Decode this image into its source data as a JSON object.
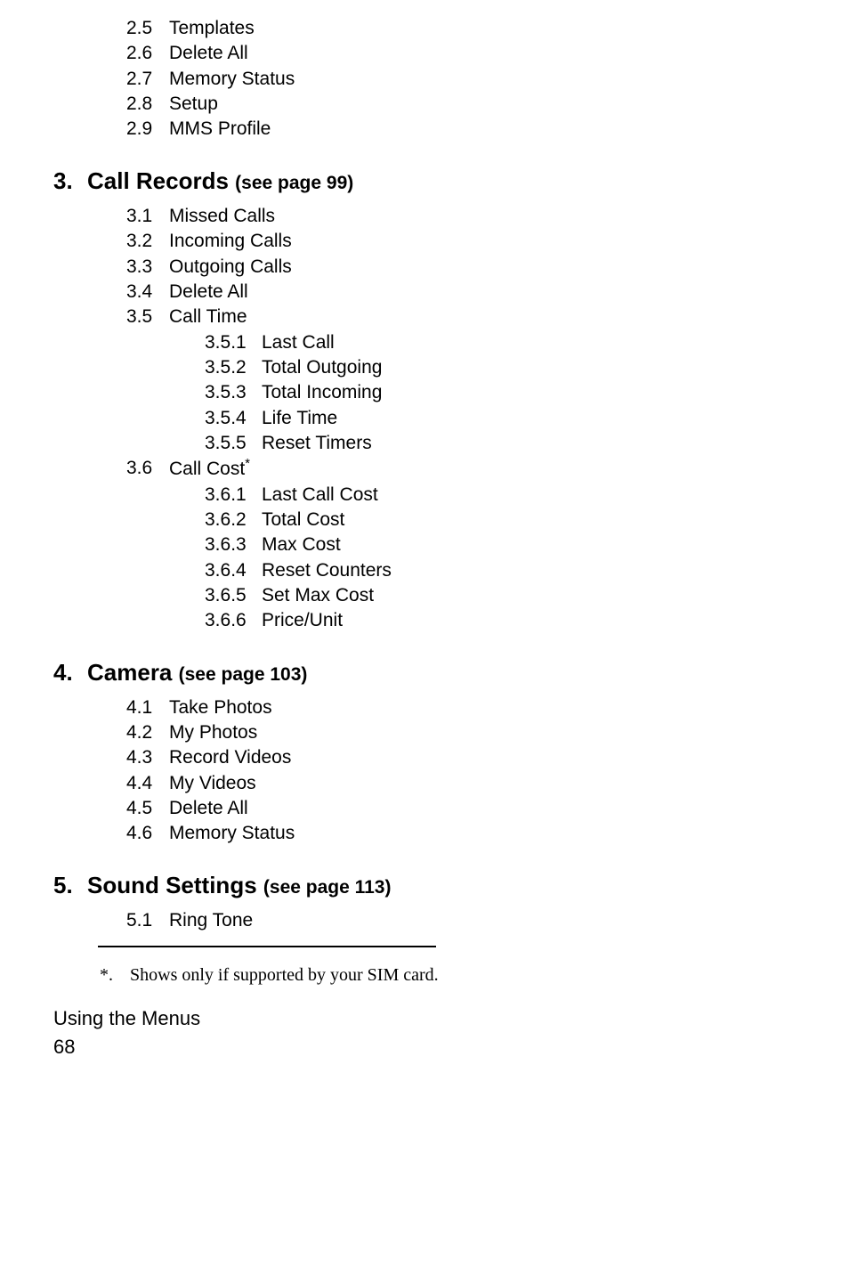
{
  "section2_tail": [
    {
      "n": "2.5",
      "t": "Templates"
    },
    {
      "n": "2.6",
      "t": "Delete All"
    },
    {
      "n": "2.7",
      "t": "Memory Status"
    },
    {
      "n": "2.8",
      "t": "Setup"
    },
    {
      "n": "2.9",
      "t": "MMS Profile"
    }
  ],
  "s3": {
    "num": "3.",
    "title": "Call Records ",
    "see": "(see page 99)",
    "items": [
      {
        "n": "3.1",
        "t": "Missed Calls"
      },
      {
        "n": "3.2",
        "t": "Incoming Calls"
      },
      {
        "n": "3.3",
        "t": "Outgoing Calls"
      },
      {
        "n": "3.4",
        "t": "Delete All"
      },
      {
        "n": "3.5",
        "t": "Call Time"
      }
    ],
    "sub35": [
      {
        "n": "3.5.1",
        "t": "Last Call"
      },
      {
        "n": "3.5.2",
        "t": "Total Outgoing"
      },
      {
        "n": "3.5.3",
        "t": "Total Incoming"
      },
      {
        "n": "3.5.4",
        "t": "Life Time"
      },
      {
        "n": "3.5.5",
        "t": "Reset Timers"
      }
    ],
    "item36": {
      "n": "3.6",
      "t": "Call Cost",
      "star": "*"
    },
    "sub36": [
      {
        "n": "3.6.1",
        "t": "Last Call Cost"
      },
      {
        "n": "3.6.2",
        "t": "Total Cost"
      },
      {
        "n": "3.6.3",
        "t": "Max Cost"
      },
      {
        "n": "3.6.4",
        "t": "Reset Counters"
      },
      {
        "n": "3.6.5",
        "t": "Set Max Cost"
      },
      {
        "n": "3.6.6",
        "t": "Price/Unit"
      }
    ]
  },
  "s4": {
    "num": "4.",
    "title": "Camera ",
    "see": "(see page 103)",
    "items": [
      {
        "n": "4.1",
        "t": "Take Photos"
      },
      {
        "n": "4.2",
        "t": "My Photos"
      },
      {
        "n": "4.3",
        "t": "Record Videos"
      },
      {
        "n": "4.4",
        "t": "My Videos"
      },
      {
        "n": "4.5",
        "t": "Delete All"
      },
      {
        "n": "4.6",
        "t": "Memory Status"
      }
    ]
  },
  "s5": {
    "num": "5.",
    "title": "Sound Settings ",
    "see": "(see page 113)",
    "items": [
      {
        "n": "5.1",
        "t": "Ring Tone"
      }
    ]
  },
  "footnote": {
    "mark": "*.",
    "text": "Shows only if supported by your SIM card."
  },
  "footer": {
    "title": "Using the Menus",
    "page": "68"
  }
}
